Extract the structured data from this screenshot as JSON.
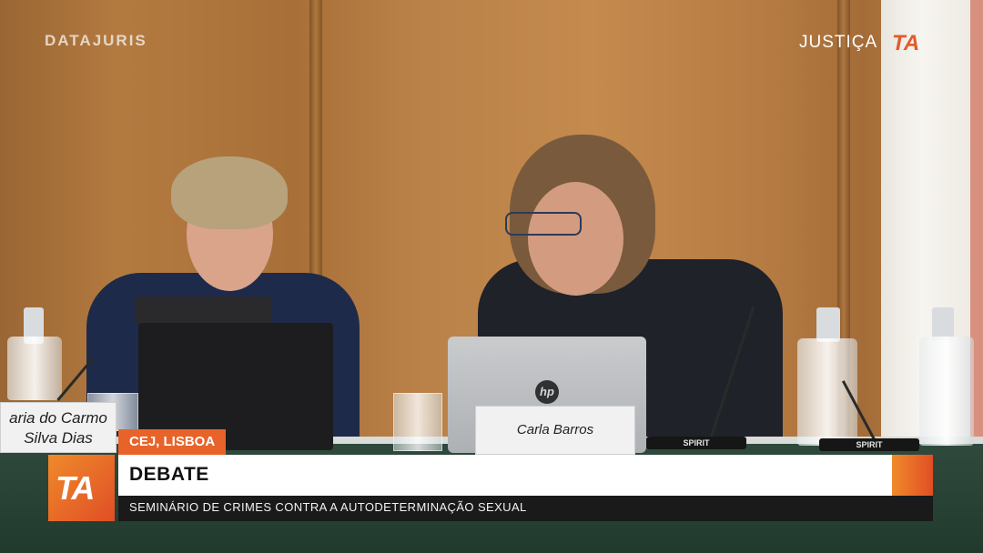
{
  "branding": {
    "top_left_logo": "DATAJURIS",
    "top_right_logo": "JUSTIÇA",
    "top_right_mark": "TA",
    "lower_block_mark": "TA"
  },
  "lower_third": {
    "location": "CEJ, LISBOA",
    "title": "DEBATE",
    "subtitle": "SEMINÁRIO DE CRIMES CONTRA A AUTODETERMINAÇÃO SEXUAL"
  },
  "nameplates": {
    "left_line1": "aria do Carmo",
    "left_line2": "Silva Dias",
    "right": "Carla Barros"
  },
  "equipment": {
    "laptop_logo": "hp",
    "mic_brand": "SPIRIT"
  },
  "colors": {
    "accent_orange": "#e8632a",
    "title_bar_bg": "#ffffff",
    "subtitle_bar_bg": "#1a1a1a"
  }
}
